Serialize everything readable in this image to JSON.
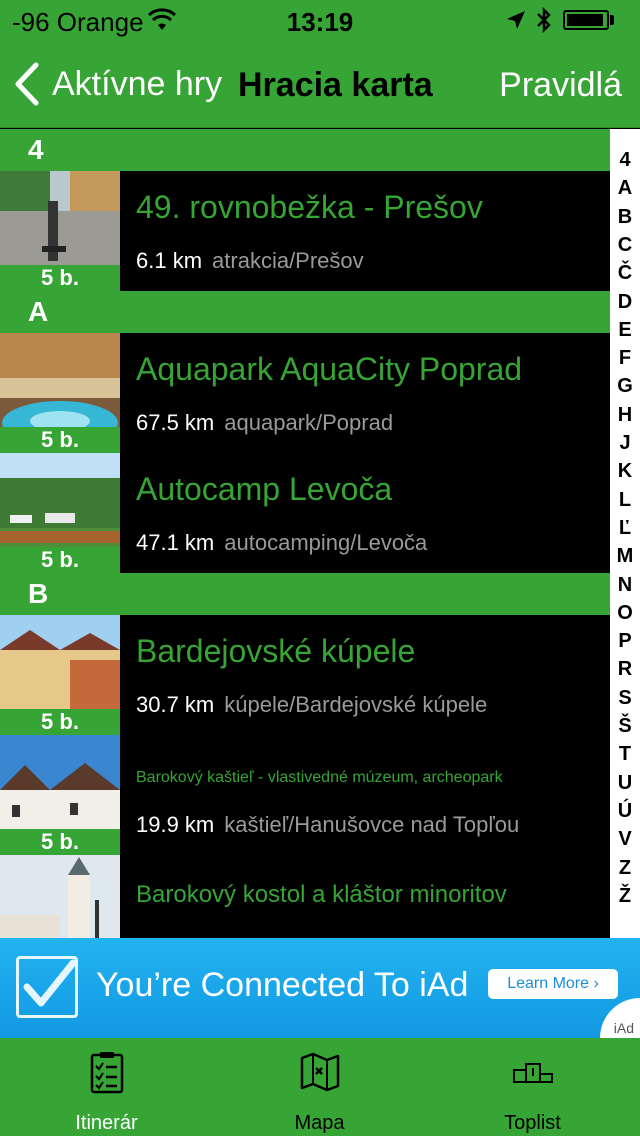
{
  "status_bar": {
    "carrier": "-96 Orange",
    "time": "13:19"
  },
  "nav": {
    "back_label": "Aktívne hry",
    "title": "Hracia karta",
    "right_label": "Pravidlá"
  },
  "sections": [
    {
      "letter": "4",
      "rows": [
        {
          "name": "49. rovnobežka - Prešov",
          "distance": "6.1 km",
          "category": "atrakcia/Prešov",
          "points": "5 b."
        }
      ]
    },
    {
      "letter": "A",
      "rows": [
        {
          "name": "Aquapark AquaCity Poprad",
          "distance": "67.5 km",
          "category": "aquapark/Poprad",
          "points": "5 b."
        },
        {
          "name": "Autocamp Levoča",
          "distance": "47.1 km",
          "category": "autocamping/Levoča",
          "points": "5 b."
        }
      ]
    },
    {
      "letter": "B",
      "rows": [
        {
          "name": "Bardejovské kúpele",
          "distance": "30.7 km",
          "category": "kúpele/Bardejovské kúpele",
          "points": "5 b."
        },
        {
          "name": "Barokový kaštieľ - vlastivedné múzeum, archeopark",
          "distance": "19.9 km",
          "category": "kaštieľ/Hanušovce nad Topľou",
          "points": "5 b."
        },
        {
          "name": "Barokový kostol a kláštor minoritov"
        }
      ]
    }
  ],
  "index_letters": [
    "4",
    "A",
    "B",
    "C",
    "Č",
    "D",
    "E",
    "F",
    "G",
    "H",
    "J",
    "K",
    "L",
    "Ľ",
    "M",
    "N",
    "O",
    "P",
    "R",
    "S",
    "Š",
    "T",
    "U",
    "Ú",
    "V",
    "Z",
    "Ž"
  ],
  "ad": {
    "headline": "You’re Connected To iAd",
    "button": "Learn More ›",
    "brand": "iAd"
  },
  "tabs": [
    {
      "label": "Itinerár",
      "icon": "clipboard-checklist-icon",
      "active": true
    },
    {
      "label": "Mapa",
      "icon": "map-icon",
      "active": false
    },
    {
      "label": "Toplist",
      "icon": "podium-icon",
      "active": false
    }
  ],
  "colors": {
    "brand_green": "#36a535",
    "ad_blue": "#1299e3"
  }
}
